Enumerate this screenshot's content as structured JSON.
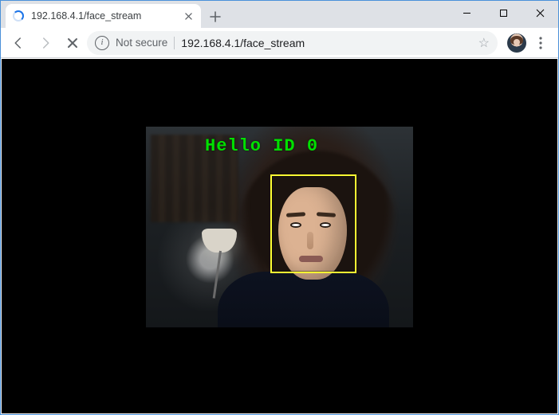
{
  "window": {
    "tab_title": "192.168.4.1/face_stream"
  },
  "toolbar": {
    "security_label": "Not secure",
    "url": "192.168.4.1/face_stream"
  },
  "stream": {
    "overlay_label": "Hello ID 0"
  }
}
